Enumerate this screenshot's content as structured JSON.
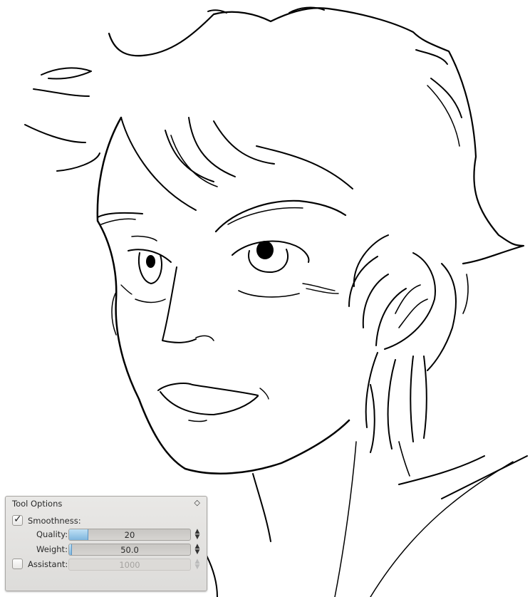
{
  "tool_options": {
    "title": "Tool Options",
    "float_icon": "diamond-icon",
    "smoothness": {
      "label": "Smoothness:",
      "checked": true
    },
    "quality": {
      "label": "Quality:",
      "value": "20",
      "fraction": 0.15
    },
    "weight": {
      "label": "Weight:",
      "value": "50.0",
      "fraction": 0.02
    },
    "assistant": {
      "label": "Assistant:",
      "checked": false,
      "value": "1000",
      "enabled": false
    }
  },
  "colors": {
    "accent": "#7fb6de",
    "panel": "#e3e2e0",
    "canvas": "#ffffff",
    "ink": "#000000"
  }
}
